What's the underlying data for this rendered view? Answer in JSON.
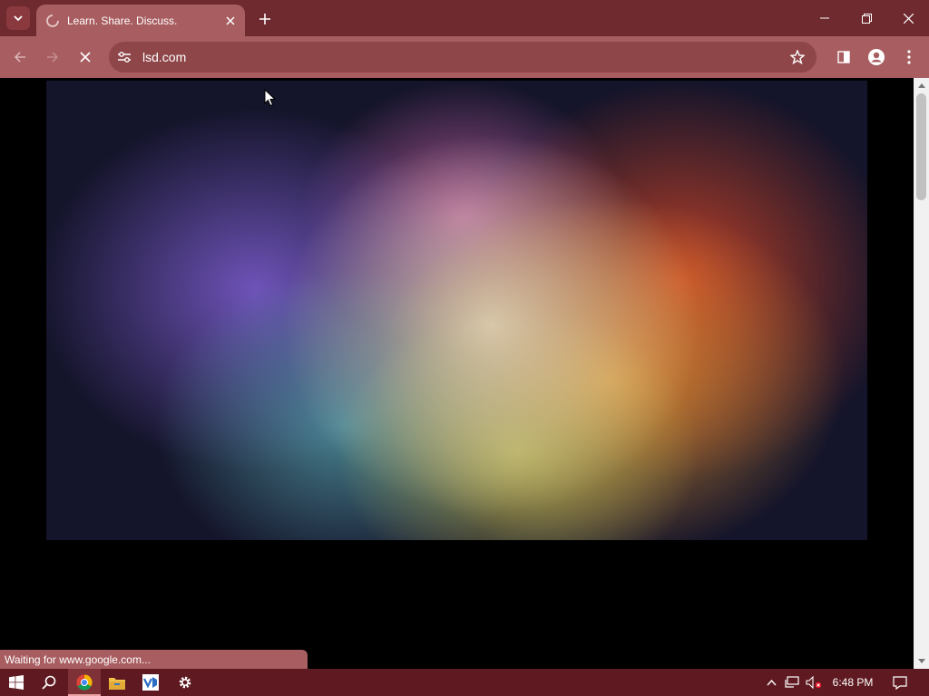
{
  "browser": {
    "tab": {
      "title": "Learn. Share. Discuss."
    },
    "address_bar": {
      "url": "lsd.com"
    },
    "status_text": "Waiting for www.google.com..."
  },
  "icons": {
    "tab_search": "chevron-down-icon",
    "favicon": "loading-spinner-icon",
    "tab_close": "close-icon",
    "new_tab": "plus-icon",
    "minimize": "minimize-icon",
    "restore": "restore-icon",
    "close_window": "close-icon",
    "back": "arrow-left-icon",
    "forward": "arrow-right-icon",
    "stop": "stop-icon",
    "site_info": "tune-icon",
    "bookmark": "star-icon",
    "side_panel": "side-panel-icon",
    "profile": "profile-icon",
    "menu": "kebab-menu-icon"
  },
  "taskbar": {
    "apps": [
      "start",
      "search",
      "chrome",
      "file-explorer",
      "visual-studio",
      "settings"
    ],
    "clock": "6:48 PM"
  },
  "colors": {
    "titlebar": "#6e2a2e",
    "toolbar": "#a85d60",
    "omnibox": "#8f4649",
    "taskbar": "#5e1a20"
  }
}
